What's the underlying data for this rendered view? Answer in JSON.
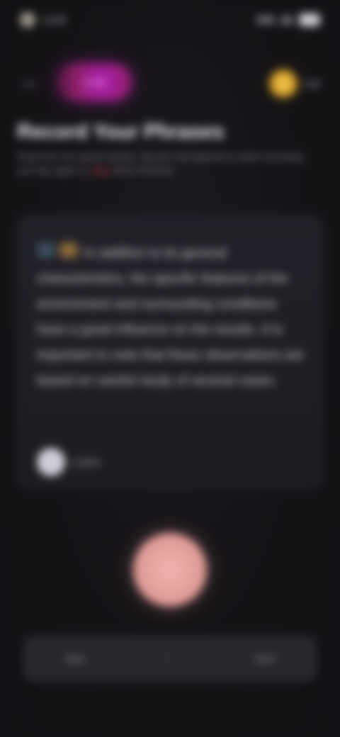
{
  "status_bar": {
    "left_text": "12:00",
    "lock_icon": "lock-icon",
    "signal_icon": "signal-icon",
    "wifi_icon": "wifi-icon",
    "battery_icon": "battery-icon"
  },
  "header": {
    "back_icon": "back-arrow-icon",
    "brand_label": "LIVE",
    "coin_icon": "coin-icon",
    "coin_count": "120"
  },
  "page": {
    "title": "Record Your Phrases",
    "subtitle_part1": "Read the text aloud clearly. Tap the microphone to start recording and tap again to",
    "subtitle_accent": "stop",
    "subtitle_part2": "when finished."
  },
  "card": {
    "badges": [
      "badge-blue",
      "badge-orange"
    ],
    "text": "In addition to its general characteristics, the specific features of the environment and surrounding conditions have a great influence on the results. It is important to note that these observations are based on careful study of several cases.",
    "speaker_icon": "speaker-icon",
    "speaker_label": "Listen"
  },
  "record": {
    "icon": "microphone-icon"
  },
  "bottom": {
    "left_label": "Skip",
    "right_label": "Next"
  },
  "colors": {
    "background": "#141215",
    "brand": "#b21fb9",
    "accent": "#e04a5a",
    "record": "#f2b3ae",
    "coin": "#f4c95a"
  }
}
